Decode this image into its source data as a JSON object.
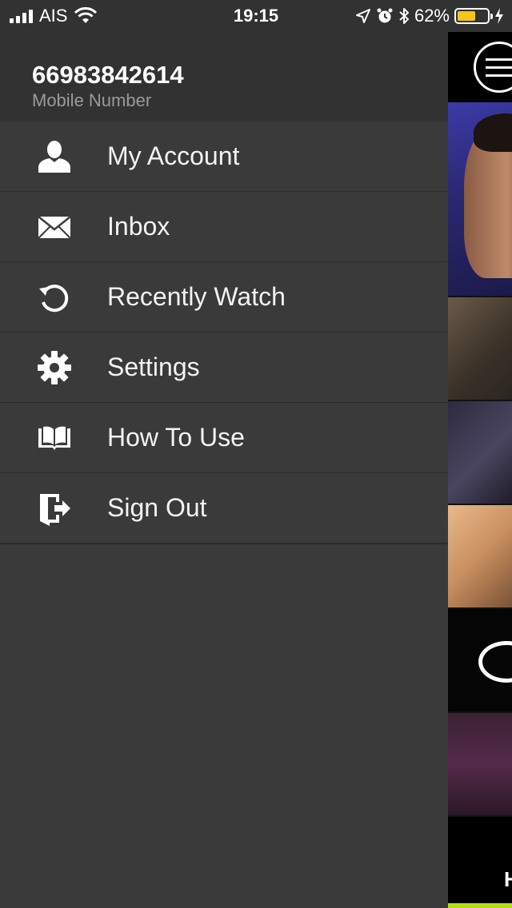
{
  "status_bar": {
    "carrier": "AIS",
    "time": "19:15",
    "battery": "62%"
  },
  "profile": {
    "number": "66983842614",
    "label": "Mobile Number"
  },
  "menu": [
    {
      "label": "My Account",
      "icon": "user-icon"
    },
    {
      "label": "Inbox",
      "icon": "envelope-icon"
    },
    {
      "label": "Recently Watch",
      "icon": "history-icon"
    },
    {
      "label": "Settings",
      "icon": "gear-icon"
    },
    {
      "label": "How To Use",
      "icon": "book-icon"
    },
    {
      "label": "Sign Out",
      "icon": "sign-out-icon"
    }
  ],
  "peek": {
    "partial_text": "H"
  },
  "colors": {
    "drawer_bg": "#3a3a3a",
    "header_bg": "#323232",
    "battery_fill": "#f5c518",
    "accent_bar": "#b3e014"
  }
}
